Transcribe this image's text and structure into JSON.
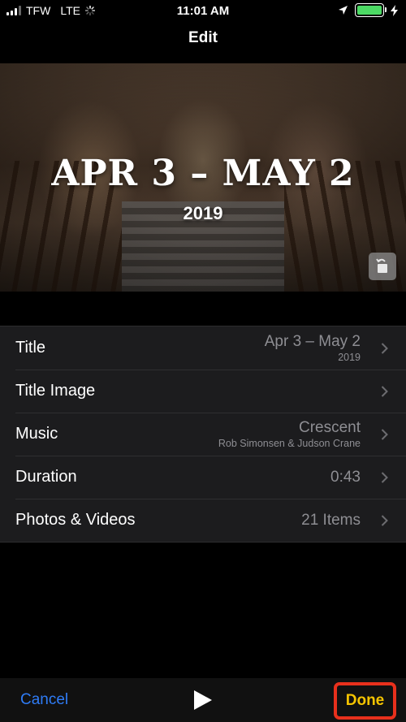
{
  "status_bar": {
    "carrier": "TFW",
    "network": "LTE",
    "time": "11:01 AM"
  },
  "nav": {
    "title": "Edit"
  },
  "hero": {
    "title": "APR 3 – MAY 2",
    "year": "2019"
  },
  "settings": [
    {
      "label": "Title",
      "value": "Apr 3 – May 2",
      "subvalue": "2019"
    },
    {
      "label": "Title Image",
      "value": "",
      "subvalue": ""
    },
    {
      "label": "Music",
      "value": "Crescent",
      "subvalue": "Rob Simonsen & Judson Crane"
    },
    {
      "label": "Duration",
      "value": "0:43",
      "subvalue": ""
    },
    {
      "label": "Photos & Videos",
      "value": "21 Items",
      "subvalue": ""
    }
  ],
  "toolbar": {
    "cancel_label": "Cancel",
    "done_label": "Done"
  },
  "colors": {
    "accent_blue": "#2f7cf6",
    "done_yellow": "#f5c400",
    "highlight_red": "#e8301c",
    "battery_green": "#4cd964"
  },
  "icons": [
    "signal-bars-icon",
    "loading-spinner-icon",
    "location-arrow-icon",
    "battery-icon",
    "charging-bolt-icon",
    "rotate-icon",
    "chevron-right-icon",
    "play-icon"
  ]
}
